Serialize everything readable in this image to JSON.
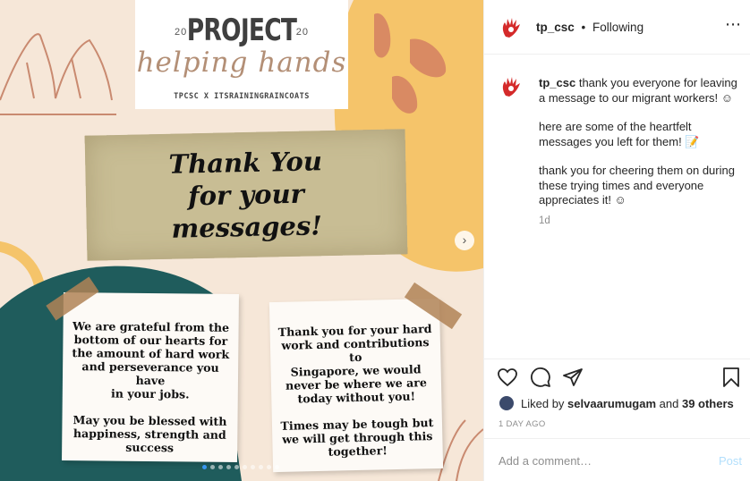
{
  "post_image": {
    "logo_year_left": "20",
    "logo_year_right": "20",
    "logo_title": "PROJECT",
    "logo_script": "helping hands",
    "logo_subtitle": "TPCSC X ITSRAININGRAINCOATS",
    "banner_text": "Thank You\nfor your\nmessages!",
    "note_left": "We are grateful from the\nbottom of our hearts for\nthe amount of hard work\nand perseverance you have\nin your jobs.\n\nMay you be blessed with\nhappiness, strength and\nsuccess",
    "note_right": "Thank you for your hard\nwork and contributions to\nSingapore, we would\nnever be where we are\ntoday without you!\n\nTimes may be tough but\nwe will get through this\ntogether!",
    "next_arrow_icon": "chevron-right-icon",
    "carousel_count": 10,
    "carousel_active_index": 0,
    "colors": {
      "background": "#f6e7d8",
      "teal": "#1f5c5c",
      "mustard": "#f5c46a",
      "terracotta": "#d98a63",
      "banner": "#c8bd94",
      "tape": "#b08256"
    }
  },
  "header": {
    "username": "tp_csc",
    "separator": "•",
    "follow_status": "Following",
    "more_icon": "more-horizontal-icon"
  },
  "caption": {
    "username": "tp_csc",
    "line1": "thank you everyone for leaving a message to our migrant workers! ☺",
    "line2": "here are some of the heartfelt messages you left for them! 📝",
    "line3": "thank you for cheering them on during these trying times and everyone appreciates it! ☺",
    "time": "1d"
  },
  "actions": {
    "like_icon": "heart-icon",
    "comment_icon": "comment-icon",
    "share_icon": "send-icon",
    "save_icon": "bookmark-icon"
  },
  "likes": {
    "prefix": "Liked by ",
    "user": "selvaarumugam",
    "suffix": " and ",
    "others": "39 others"
  },
  "timestamp": "1 DAY AGO",
  "comment": {
    "placeholder": "Add a comment…",
    "post_label": "Post"
  }
}
